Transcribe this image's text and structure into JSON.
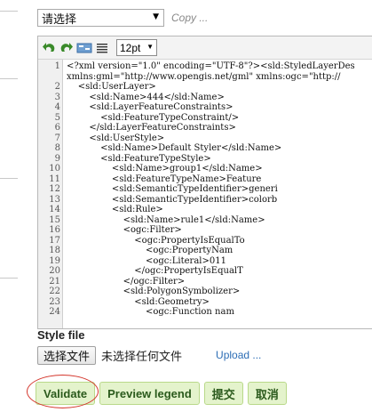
{
  "template": {
    "selected": "请选择",
    "copy_label": "Copy ..."
  },
  "editor": {
    "toolbar": {
      "undo_icon": "undo-icon",
      "redo_icon": "redo-icon",
      "search_icon": "search-replace-icon",
      "format_icon": "format-icon",
      "font_size": "12pt"
    },
    "lines": [
      {
        "n": "1",
        "text": "<?xml version=\"1.0\" encoding=\"UTF-8\"?><sld:StyledLayerDes"
      },
      {
        "n": "",
        "text": "xmlns:gml=\"http://www.opengis.net/gml\" xmlns:ogc=\"http://"
      },
      {
        "n": "2",
        "text": "    <sld:UserLayer>"
      },
      {
        "n": "3",
        "text": "        <sld:Name>444</sld:Name>"
      },
      {
        "n": "4",
        "text": "        <sld:LayerFeatureConstraints>"
      },
      {
        "n": "5",
        "text": "            <sld:FeatureTypeConstraint/>"
      },
      {
        "n": "6",
        "text": "        </sld:LayerFeatureConstraints>"
      },
      {
        "n": "7",
        "text": "        <sld:UserStyle>"
      },
      {
        "n": "8",
        "text": "            <sld:Name>Default Styler</sld:Name>"
      },
      {
        "n": "9",
        "text": "            <sld:FeatureTypeStyle>"
      },
      {
        "n": "10",
        "text": "                <sld:Name>group1</sld:Name>"
      },
      {
        "n": "11",
        "text": "                <sld:FeatureTypeName>Feature"
      },
      {
        "n": "12",
        "text": "                <sld:SemanticTypeIdentifier>generi"
      },
      {
        "n": "13",
        "text": "                <sld:SemanticTypeIdentifier>colorb"
      },
      {
        "n": "14",
        "text": "                <sld:Rule>"
      },
      {
        "n": "15",
        "text": "                    <sld:Name>rule1</sld:Name>"
      },
      {
        "n": "16",
        "text": "                    <ogc:Filter>"
      },
      {
        "n": "17",
        "text": "                        <ogc:PropertyIsEqualTo"
      },
      {
        "n": "18",
        "text": "                            <ogc:PropertyNam"
      },
      {
        "n": "19",
        "text": "                            <ogc:Literal>011"
      },
      {
        "n": "20",
        "text": "                        </ogc:PropertyIsEqualT"
      },
      {
        "n": "21",
        "text": "                    </ogc:Filter>"
      },
      {
        "n": "22",
        "text": "                    <sld:PolygonSymbolizer>"
      },
      {
        "n": "23",
        "text": "                        <sld:Geometry>"
      },
      {
        "n": "24",
        "text": "                            <ogc:Function nam"
      }
    ]
  },
  "style_file": {
    "label": "Style file",
    "choose_button": "选择文件",
    "status": "未选择任何文件",
    "upload_link": "Upload ..."
  },
  "buttons": {
    "validate": "Validate",
    "preview": "Preview legend",
    "submit": "提交",
    "cancel": "取消"
  },
  "colors": {
    "button_bg": "#e4f3cc",
    "button_text": "#2b5a1c",
    "annotation_ring": "#d4352b",
    "link": "#2c6db5"
  }
}
